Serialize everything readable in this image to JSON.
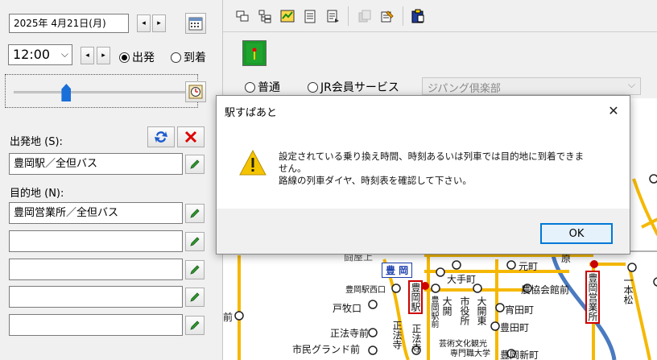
{
  "left": {
    "date_value": "2025年 4月21日(月)",
    "time_value": "12:00",
    "radio_depart": "出発",
    "radio_arrive": "到着",
    "origin_label": "出発地 (S):",
    "origin_value": "豊岡駅／全但バス",
    "dest_label": "目的地 (N):",
    "dest_value": "豊岡営業所／全但バス",
    "via": [
      "",
      "",
      "",
      "",
      ""
    ],
    "slider_position_fraction": 0.3
  },
  "right": {
    "radio_normal": "普通",
    "radio_jr": "JR会員サービス",
    "combo_value": "ジパング倶楽部",
    "map_stations": {
      "fuokazaki": "闘屋上",
      "toyooka_area": "豊 岡",
      "genpuku": "元町",
      "gen": "原",
      "otemachi": "大手町",
      "toyookaeki_nishiguchi": "豊岡駅西口",
      "nokyo": "農協会館前",
      "tomaku": "戸牧口",
      "uoeda": "宵田町",
      "toyotamachi": "豊田町",
      "shoho": "正法寺前",
      "citizen": "市民グランド前",
      "geijutsu": "芸術文化観光",
      "senmon": "専門職大学",
      "toyooka_shinmachi": "豊岡新町",
      "mae": "前",
      "v_toyooka_eki": "豊岡駅",
      "v_toyooka_ekimae": "豊岡駅前",
      "v_ookai": "大開",
      "v_shiyakusho": "市役所",
      "v_daikaihigashi": "大開東",
      "v_shoho": "正法寺",
      "v_shoho2": "正法寺",
      "v_eigyosho": "豊岡営業所",
      "v_ippon": "一本松"
    }
  },
  "dialog": {
    "title": "駅すぱあと",
    "close": "✕",
    "message_line1": "設定されている乗り換え時間、時刻あるいは列車では目的地に到着できま",
    "message_line2": "せん。",
    "message_line3": "路線の列車ダイヤ、時刻表を確認して下さい。",
    "ok_label": "OK"
  },
  "colors": {
    "accent": "#0078d7",
    "route_yellow": "#f5b800",
    "route_gray": "#9a9a9a",
    "river_blue": "#4a7ac0",
    "station_red": "#cc0000",
    "warning": "#f5c400"
  }
}
